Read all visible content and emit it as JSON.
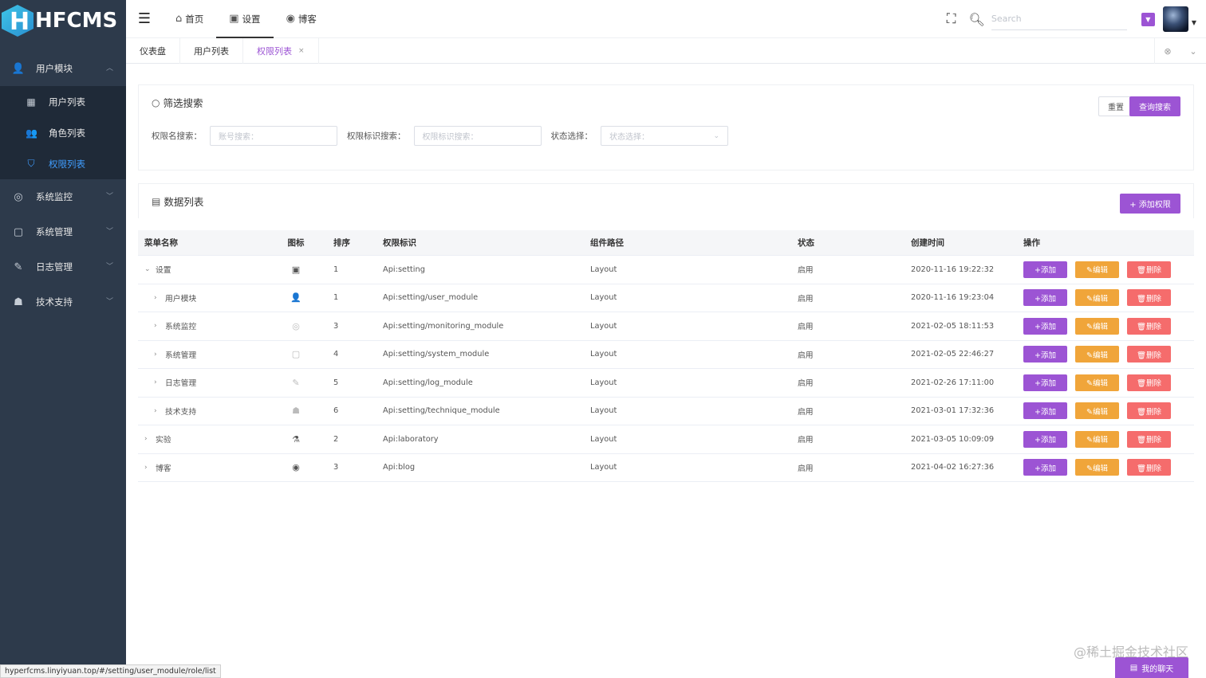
{
  "app": {
    "logo_text": "HFCMS",
    "logo_letter": "H"
  },
  "sidebar": {
    "groups": [
      {
        "label": "用户模块",
        "icon": "user-icon",
        "glyph": "👤",
        "expanded": true,
        "items": [
          {
            "label": "用户列表",
            "icon": "grid-list-icon",
            "glyph": "▦"
          },
          {
            "label": "角色列表",
            "icon": "user-role-icon",
            "glyph": "👥"
          },
          {
            "label": "权限列表",
            "icon": "shield-icon",
            "glyph": "⛉",
            "active": true
          }
        ]
      },
      {
        "label": "系统监控",
        "icon": "monitor-icon",
        "glyph": "◎"
      },
      {
        "label": "系统管理",
        "icon": "system-icon",
        "glyph": "▢"
      },
      {
        "label": "日志管理",
        "icon": "edit-icon",
        "glyph": "✎"
      },
      {
        "label": "技术支持",
        "icon": "support-icon",
        "glyph": "☗"
      }
    ]
  },
  "header": {
    "nav": [
      {
        "label": "首页",
        "icon": "home-icon",
        "glyph": "⌂"
      },
      {
        "label": "设置",
        "icon": "settings-icon",
        "glyph": "▣",
        "active": true
      },
      {
        "label": "博客",
        "icon": "podcast-icon",
        "glyph": "◉"
      }
    ],
    "search_placeholder": "Search"
  },
  "tags": [
    {
      "label": "仪表盘"
    },
    {
      "label": "用户列表"
    },
    {
      "label": "权限列表",
      "active": true,
      "close": "×"
    }
  ],
  "filter": {
    "title": "筛选搜索",
    "reset_label": "重置",
    "query_label": "查询搜索",
    "fields": [
      {
        "label": "权限名搜索：",
        "placeholder": "账号搜索："
      },
      {
        "label": "权限标识搜索：",
        "placeholder": "权限标识搜索："
      },
      {
        "label": "状态选择：",
        "placeholder": "状态选择："
      }
    ]
  },
  "list": {
    "title": "数据列表",
    "add_label": "+ 添加权限"
  },
  "table": {
    "columns": [
      "菜单名称",
      "图标",
      "排序",
      "权限标识",
      "组件路径",
      "状态",
      "创建时间",
      "操作"
    ],
    "action_labels": {
      "add": "+添加",
      "edit": "✎编辑",
      "del": "🗑删除"
    },
    "rows": [
      {
        "name": "设置",
        "level": 0,
        "expanded": true,
        "icon": "settings-icon",
        "glyph": "▣",
        "sort": "1",
        "perm": "Api:setting",
        "component": "Layout",
        "status": "启用",
        "created": "2020-11-16 19:22:32"
      },
      {
        "name": "用户模块",
        "level": 1,
        "icon": "user-icon",
        "glyph": "👤",
        "sort": "1",
        "perm": "Api:setting/user_module",
        "component": "Layout",
        "status": "启用",
        "created": "2020-11-16 19:23:04"
      },
      {
        "name": "系统监控",
        "level": 1,
        "icon": "monitor-icon",
        "glyph": "◎",
        "light": true,
        "sort": "3",
        "perm": "Api:setting/monitoring_module",
        "component": "Layout",
        "status": "启用",
        "created": "2021-02-05 18:11:53"
      },
      {
        "name": "系统管理",
        "level": 1,
        "icon": "system-icon",
        "glyph": "▢",
        "light": true,
        "sort": "4",
        "perm": "Api:setting/system_module",
        "component": "Layout",
        "status": "启用",
        "created": "2021-02-05 22:46:27"
      },
      {
        "name": "日志管理",
        "level": 1,
        "icon": "edit-icon",
        "glyph": "✎",
        "light": true,
        "sort": "5",
        "perm": "Api:setting/log_module",
        "component": "Layout",
        "status": "启用",
        "created": "2021-02-26 17:11:00"
      },
      {
        "name": "技术支持",
        "level": 1,
        "icon": "support-icon",
        "glyph": "☗",
        "light": true,
        "sort": "6",
        "perm": "Api:setting/technique_module",
        "component": "Layout",
        "status": "启用",
        "created": "2021-03-01 17:32:36"
      },
      {
        "name": "实验",
        "level": 0,
        "icon": "flask-icon",
        "glyph": "⚗",
        "sort": "2",
        "perm": "Api:laboratory",
        "component": "Layout",
        "status": "启用",
        "created": "2021-03-05 10:09:09"
      },
      {
        "name": "博客",
        "level": 0,
        "icon": "podcast-icon",
        "glyph": "◉",
        "sort": "3",
        "perm": "Api:blog",
        "component": "Layout",
        "status": "启用",
        "created": "2021-04-02 16:27:36"
      }
    ]
  },
  "footer": {
    "status_url": "hyperfcms.linyiyuan.top/#/setting/user_module/role/list",
    "watermark": "@稀土掘金技术社区",
    "chat_label": "我的聊天",
    "chat_glyph": "▤"
  },
  "colors": {
    "sidebar": "#2d3a4b",
    "accent": "#9c54d4",
    "edit": "#f0a53a",
    "delete": "#f56c6c",
    "active_menu": "#409eff"
  }
}
